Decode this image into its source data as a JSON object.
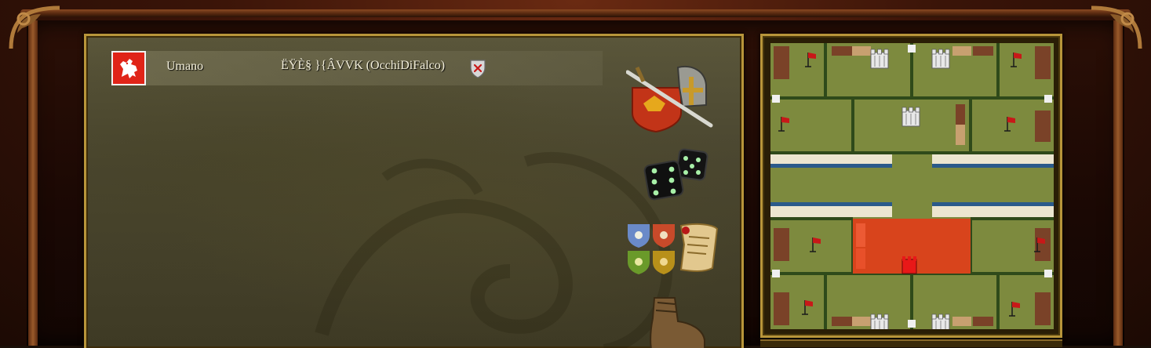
{
  "player": {
    "type": "Umano",
    "name": "ËŸÈ§ }{ÂVVK (OcchiDiFalco)",
    "crest_color": "#e02418"
  },
  "icons": [
    {
      "name": "battle-helmet-sword-icon"
    },
    {
      "name": "dice-icon"
    },
    {
      "name": "team-shields-scroll-icon"
    },
    {
      "name": "boot-icon"
    }
  ],
  "map": {
    "team_colors": {
      "selected_zone": "#d8441c",
      "castle": "#e8e8e8",
      "flag": "#c81818",
      "player_keep": "#e81818"
    }
  }
}
